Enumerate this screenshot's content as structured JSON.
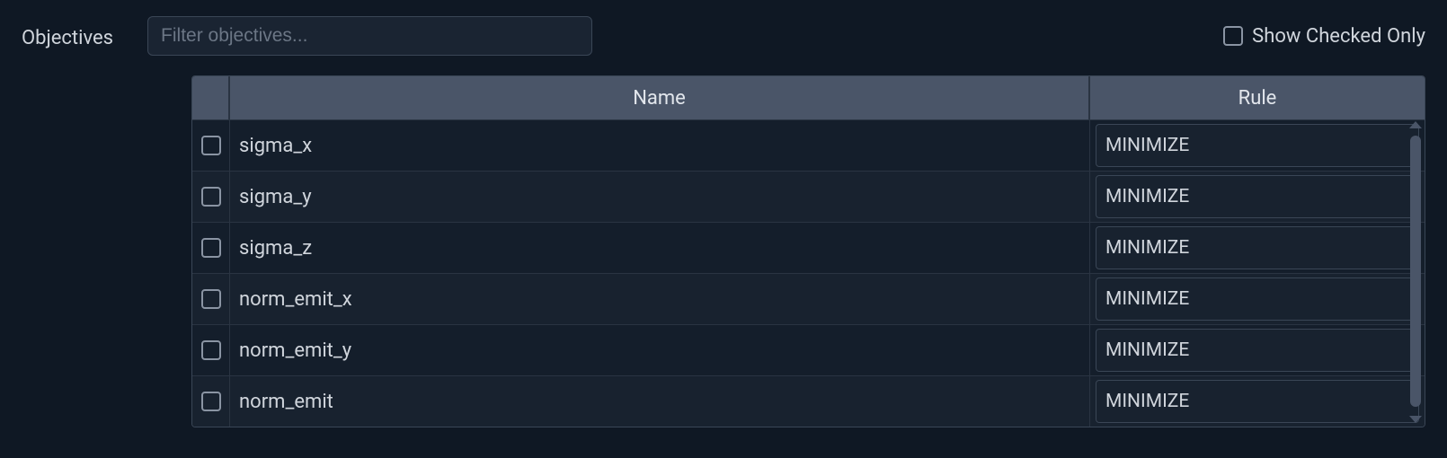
{
  "section": {
    "label": "Objectives"
  },
  "filter": {
    "placeholder": "Filter objectives..."
  },
  "showCheckedOnly": {
    "label": "Show Checked Only"
  },
  "columns": {
    "name": "Name",
    "rule": "Rule"
  },
  "rows": [
    {
      "name": "sigma_x",
      "rule": "MINIMIZE"
    },
    {
      "name": "sigma_y",
      "rule": "MINIMIZE"
    },
    {
      "name": "sigma_z",
      "rule": "MINIMIZE"
    },
    {
      "name": "norm_emit_x",
      "rule": "MINIMIZE"
    },
    {
      "name": "norm_emit_y",
      "rule": "MINIMIZE"
    },
    {
      "name": "norm_emit",
      "rule": "MINIMIZE"
    }
  ]
}
